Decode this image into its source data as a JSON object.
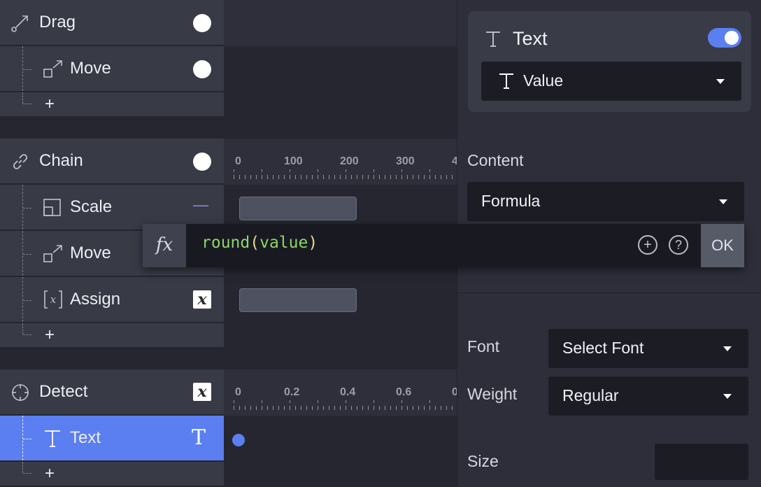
{
  "layers": {
    "drag": {
      "label": "Drag"
    },
    "drag_move": {
      "label": "Move"
    },
    "chain": {
      "label": "Chain"
    },
    "chain_scale": {
      "label": "Scale",
      "indicator": "—"
    },
    "chain_move": {
      "label": "Move"
    },
    "chain_assign": {
      "label": "Assign",
      "badge": "x"
    },
    "detect": {
      "label": "Detect",
      "badge": "x"
    },
    "detect_text": {
      "label": "Text",
      "badge": "T"
    },
    "add_label": "+"
  },
  "timeline": {
    "ruler1": [
      "0",
      "100",
      "200",
      "300",
      "4"
    ],
    "ruler2": [
      "0",
      "0.2",
      "0.4",
      "0.6",
      "0"
    ]
  },
  "properties": {
    "type_card": {
      "icon": "T",
      "title": "Text",
      "enabled": true,
      "value_icon": "T",
      "value_label": "Value"
    },
    "content_label": "Content",
    "content_value": "Formula",
    "font_label": "Font",
    "font_value": "Select Font",
    "weight_label": "Weight",
    "weight_value": "Regular",
    "size_label": "Size"
  },
  "formula": {
    "fx_label": "fx",
    "fn_name": "round",
    "open_paren": "(",
    "arg": "value",
    "close_paren": ")",
    "add_icon": "plus-circle-icon",
    "help_icon": "question-circle-icon",
    "ok_label": "OK"
  },
  "colors": {
    "accent": "#5b7ff0",
    "function": "#8fd46a",
    "paren": "#e9d48a"
  }
}
